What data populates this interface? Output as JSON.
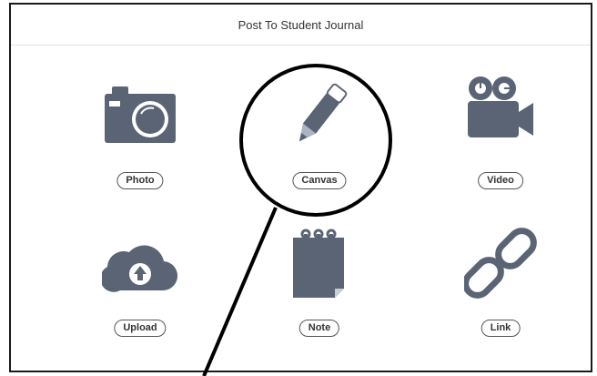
{
  "dialog": {
    "title": "Post To Student Journal"
  },
  "options": [
    {
      "label": "Photo",
      "icon": "camera-icon"
    },
    {
      "label": "Canvas",
      "icon": "pencil-icon"
    },
    {
      "label": "Video",
      "icon": "video-camera-icon"
    },
    {
      "label": "Upload",
      "icon": "cloud-upload-icon"
    },
    {
      "label": "Note",
      "icon": "notepad-icon"
    },
    {
      "label": "Link",
      "icon": "chain-link-icon"
    }
  ],
  "colors": {
    "icon": "#5a6474",
    "border": "#1a1a1a",
    "annotation": "#000000"
  }
}
